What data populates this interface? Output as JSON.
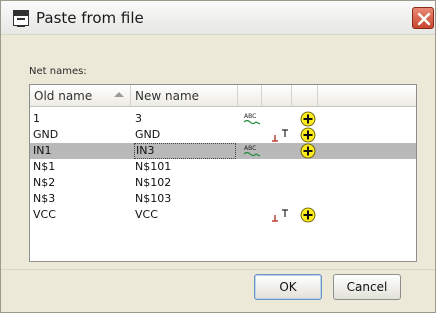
{
  "window": {
    "title": "Paste from file",
    "icons": {
      "app": "paste-window-icon",
      "close": "close-icon"
    }
  },
  "net_names_label": "Net names:",
  "table": {
    "columns": [
      "Old name",
      "New name"
    ],
    "sorted_column": "Old name",
    "sort_direction": "ascending",
    "rows": [
      {
        "old": "1",
        "new": "3",
        "abc": true,
        "term": false,
        "plus": true,
        "selected": false
      },
      {
        "old": "GND",
        "new": "GND",
        "abc": false,
        "term": true,
        "plus": true,
        "selected": false
      },
      {
        "old": "IN1",
        "new": "IN3",
        "abc": true,
        "term": false,
        "plus": true,
        "selected": true
      },
      {
        "old": "N$1",
        "new": "N$101",
        "abc": false,
        "term": false,
        "plus": false,
        "selected": false
      },
      {
        "old": "N$2",
        "new": "N$102",
        "abc": false,
        "term": false,
        "plus": false,
        "selected": false
      },
      {
        "old": "N$3",
        "new": "N$103",
        "abc": false,
        "term": false,
        "plus": false,
        "selected": false
      },
      {
        "old": "VCC",
        "new": "VCC",
        "abc": false,
        "term": true,
        "plus": true,
        "selected": false
      }
    ],
    "icon_names": {
      "abc": "abc-rename-icon",
      "term": "supply-terminal-icon",
      "plus": "add-plus-icon"
    },
    "colors": {
      "selected_row": "#b9b9b9",
      "plus_fill": "#ffec1f",
      "plus_stroke": "#5a4b00",
      "abc_wave": "#1e8a3a",
      "term_mark": "#b22a1e"
    }
  },
  "buttons": {
    "ok": "OK",
    "cancel": "Cancel"
  }
}
